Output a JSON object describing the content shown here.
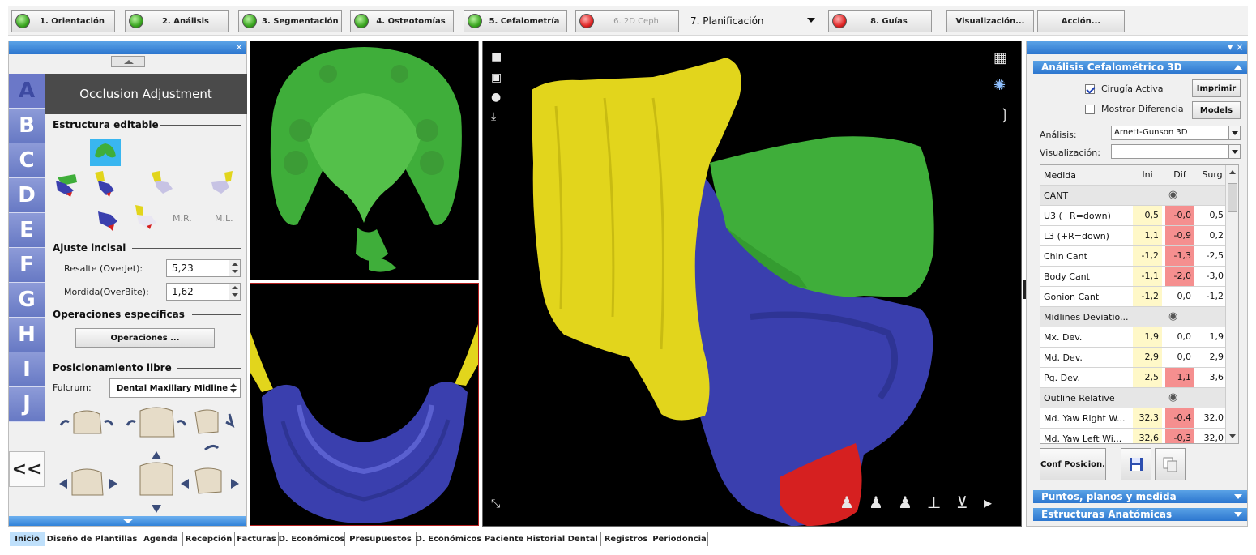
{
  "toolbar": {
    "steps": [
      {
        "label": "1. Orientación",
        "status": "green"
      },
      {
        "label": "2. Análisis",
        "status": "green"
      },
      {
        "label": "3. Segmentación",
        "status": "green"
      },
      {
        "label": "4. Osteotomías",
        "status": "green"
      },
      {
        "label": "5. Cefalometría",
        "status": "green"
      },
      {
        "label": "6. 2D Ceph",
        "status": "red"
      },
      {
        "label": "8. Guías",
        "status": "red"
      }
    ],
    "planning_combo": "7. Planificación",
    "visualization_btn": "Visualización...",
    "action_btn": "Acción..."
  },
  "left": {
    "letters": [
      "A",
      "B",
      "C",
      "D",
      "E",
      "F",
      "G",
      "H",
      "I",
      "J"
    ],
    "title": "Occlusion Adjustment",
    "sec_editable": "Estructura editable",
    "mr_label": "M.R.",
    "ml_label": "M.L.",
    "sec_incisal": "Ajuste incisal",
    "overjet_label": "Resalte (OverJet):",
    "overjet_value": "5,23",
    "overbite_label": "Mordida(OverBite):",
    "overbite_value": "1,62",
    "sec_ops": "Operaciones específicas",
    "ops_btn": "Operaciones ...",
    "sec_free": "Posicionamiento libre",
    "fulcrum_label": "Fulcrum:",
    "fulcrum_value": "Dental Maxillary Midline",
    "collapse": "<<"
  },
  "right": {
    "analysis_header": "Análisis Cefalométrico 3D",
    "cirugia": "Cirugía Activa",
    "mostrar": "Mostrar Diferencia",
    "imprimir": "Imprimir",
    "models": "Models",
    "analisis_label": "Análisis:",
    "analisis_value": "Arnett-Gunson 3D",
    "visualizacion_label": "Visualización:",
    "visualizacion_value": "",
    "table": {
      "headers": [
        "Medida",
        "Ini",
        "Dif",
        "Surg"
      ],
      "rows": [
        {
          "type": "group",
          "name": "CANT"
        },
        {
          "type": "row",
          "name": "U3 (+R=down)",
          "ini": "0,5",
          "dif": "-0,0",
          "surg": "0,5",
          "dif_red": true
        },
        {
          "type": "row",
          "name": "L3 (+R=down)",
          "ini": "1,1",
          "dif": "-0,9",
          "surg": "0,2",
          "dif_red": true
        },
        {
          "type": "row",
          "name": "Chin Cant",
          "ini": "-1,2",
          "dif": "-1,3",
          "surg": "-2,5",
          "dif_red": true
        },
        {
          "type": "row",
          "name": "Body Cant",
          "ini": "-1,1",
          "dif": "-2,0",
          "surg": "-3,0",
          "dif_red": true
        },
        {
          "type": "row",
          "name": "Gonion Cant",
          "ini": "-1,2",
          "dif": "0,0",
          "surg": "-1,2",
          "dif_red": false
        },
        {
          "type": "group",
          "name": "Midlines Deviatio..."
        },
        {
          "type": "row",
          "name": "Mx. Dev.",
          "ini": "1,9",
          "dif": "0,0",
          "surg": "1,9",
          "dif_red": false
        },
        {
          "type": "row",
          "name": "Md. Dev.",
          "ini": "2,9",
          "dif": "0,0",
          "surg": "2,9",
          "dif_red": false
        },
        {
          "type": "row",
          "name": "Pg. Dev.",
          "ini": "2,5",
          "dif": "1,1",
          "surg": "3,6",
          "dif_red": true
        },
        {
          "type": "group",
          "name": "Outline Relative"
        },
        {
          "type": "row",
          "name": "Md. Yaw Right W...",
          "ini": "32,3",
          "dif": "-0,4",
          "surg": "32,0",
          "dif_red": true
        },
        {
          "type": "row",
          "name": "Md. Yaw Left Wi...",
          "ini": "32,6",
          "dif": "-0,3",
          "surg": "32,0",
          "dif_red": true
        }
      ]
    },
    "conf_btn": "Conf Posicion.",
    "puntos_header": "Puntos, planos y medida",
    "estructuras_header": "Estructuras Anatómicas"
  },
  "tabs": [
    "Inicio",
    "Diseño de Plantillas",
    "Agenda",
    "Recepción",
    "Facturas",
    "D. Económicos",
    "Presupuestos",
    "D. Económicos Paciente",
    "Historial Dental",
    "Registros",
    "Periodoncia"
  ],
  "colors": {
    "maxilla": "#3fae3a",
    "mandible": "#3a3fae",
    "skull": "#e2d51c",
    "chin": "#d62020",
    "diff_red": "#f58f8f",
    "ini_yellow": "#fff8c8"
  }
}
